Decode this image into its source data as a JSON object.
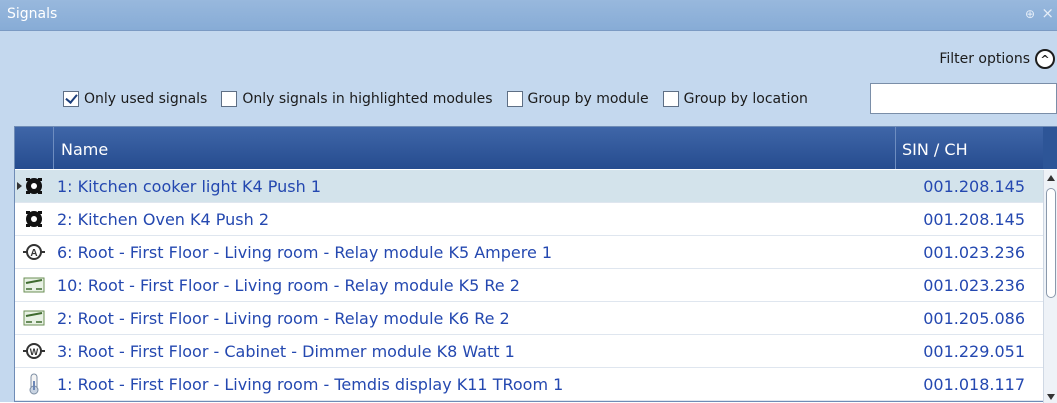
{
  "window": {
    "title": "Signals",
    "pin_glyph": "⊕",
    "close_glyph": "×"
  },
  "filter_options": {
    "label": "Filter options",
    "toggle_glyph": "^"
  },
  "filters": [
    {
      "label": "Only used signals",
      "checked": true
    },
    {
      "label": "Only signals in highlighted modules",
      "checked": false
    },
    {
      "label": "Group by module",
      "checked": false
    },
    {
      "label": "Group by location",
      "checked": false
    }
  ],
  "search": {
    "value": ""
  },
  "table": {
    "columns": {
      "name": "Name",
      "sin": "SIN / CH"
    },
    "rows": [
      {
        "name": "1: Kitchen cooker light K4 Push 1",
        "sin": "001.208.145",
        "icon": "push-button-icon",
        "selected": true
      },
      {
        "name": "2: Kitchen Oven K4 Push 2",
        "sin": "001.208.145",
        "icon": "push-button-icon",
        "selected": false
      },
      {
        "name": "6: Root - First Floor - Living room - Relay module K5 Ampere 1",
        "sin": "001.023.236",
        "icon": "ampere-meter-icon",
        "selected": false
      },
      {
        "name": "10: Root - First Floor - Living room - Relay module K5 Re 2",
        "sin": "001.023.236",
        "icon": "relay-icon",
        "selected": false
      },
      {
        "name": "2: Root - First Floor - Living room - Relay module K6 Re 2",
        "sin": "001.205.086",
        "icon": "relay-icon",
        "selected": false
      },
      {
        "name": "3: Root - First Floor - Cabinet - Dimmer module K8 Watt 1",
        "sin": "001.229.051",
        "icon": "watt-meter-icon",
        "selected": false
      },
      {
        "name": "1: Root - First Floor - Living room - Temdis display K11 TRoom 1",
        "sin": "001.018.117",
        "icon": "thermometer-icon",
        "selected": false
      }
    ]
  },
  "colors": {
    "panel_bg": "#c4d8ee",
    "header_bg": "#2f5697",
    "row_text": "#2448b0",
    "selected_row": "#d3e3eb"
  }
}
